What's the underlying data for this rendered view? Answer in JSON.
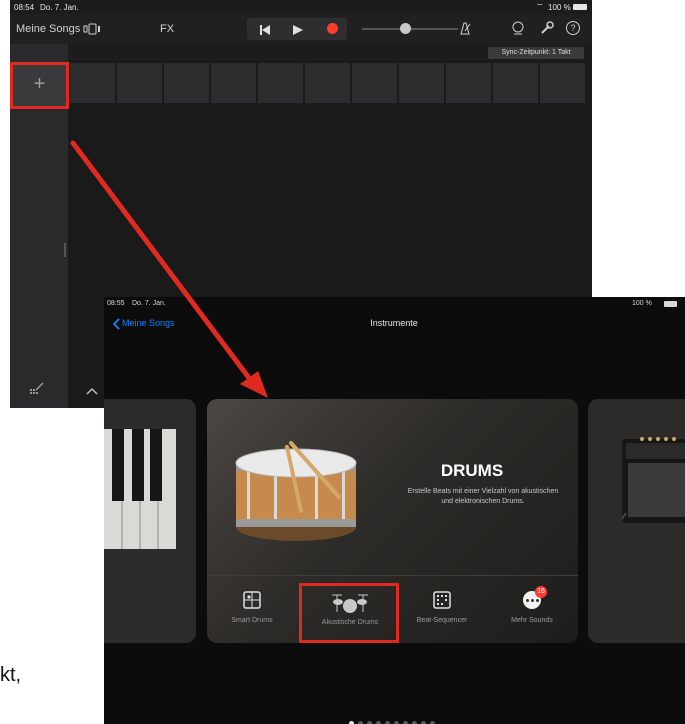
{
  "top_screen": {
    "status": {
      "time": "08:54",
      "date": "Do. 7. Jan.",
      "battery": "100 %"
    },
    "toolbar": {
      "my_songs": "Meine Songs",
      "fx": "FX",
      "sync_label": "Sync-Zeitpunkt: 1 Takt"
    },
    "sidebar": {
      "add_symbol": "+"
    }
  },
  "bottom_screen": {
    "status": {
      "time": "08:55",
      "date": "Do. 7. Jan.",
      "battery": "100 %"
    },
    "nav": {
      "back_label": "Meine Songs",
      "title": "Instrumente"
    },
    "drums_card": {
      "title": "DRUMS",
      "description": "Erstelle Beats mit einer Vielzahl von akustischen und elektronischen Drums."
    },
    "options": [
      {
        "label": "Smart Drums",
        "icon": "smart-drums-icon"
      },
      {
        "label": "Akustische Drums",
        "icon": "drum-kit-icon"
      },
      {
        "label": "Beat-Sequencer",
        "icon": "beat-sequencer-icon"
      },
      {
        "label": "Mehr Sounds",
        "icon": "more-icon",
        "badge": "16"
      }
    ]
  },
  "annotations": {
    "partial_text": "kt,"
  },
  "colors": {
    "highlight": "#e12a1f",
    "accent_blue": "#0a84ff",
    "record": "#ff3b30"
  }
}
